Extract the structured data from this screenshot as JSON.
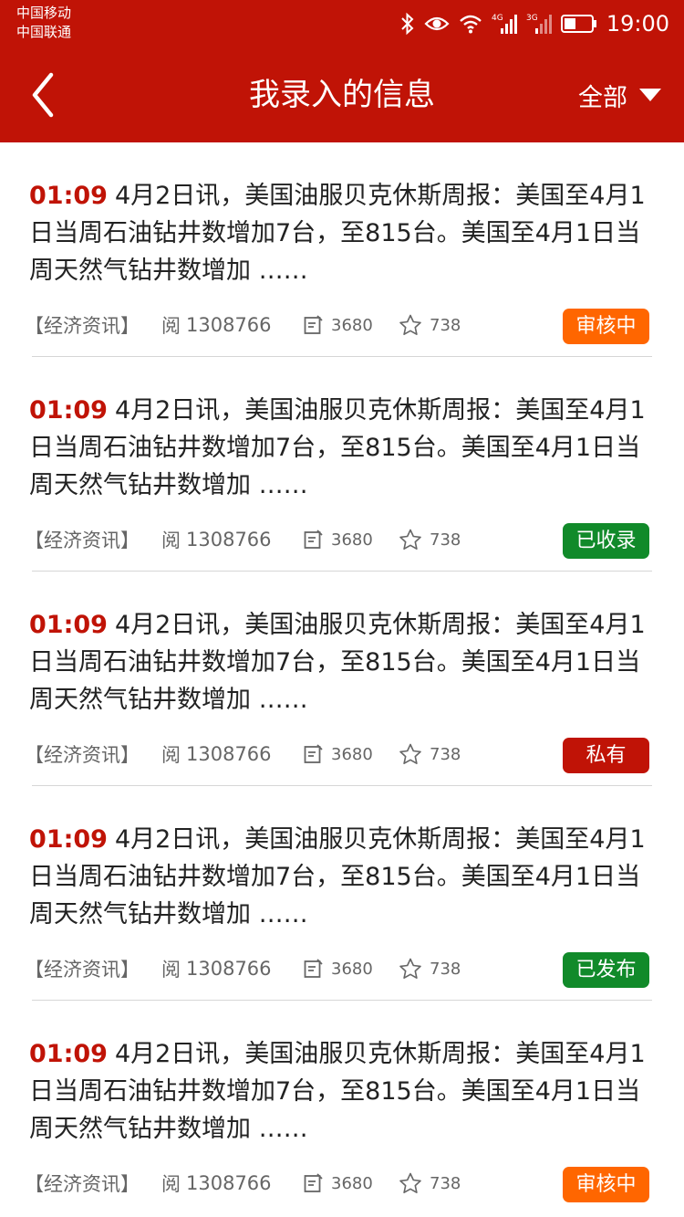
{
  "status_bar": {
    "carrier_1": "中国移动",
    "carrier_2": "中国联通",
    "network_1": "4G",
    "network_2": "3G",
    "time": "19:00",
    "icons": [
      "bluetooth-icon",
      "eye-icon",
      "wifi-icon",
      "signal-icon",
      "battery-icon"
    ]
  },
  "header": {
    "title": "我录入的信息",
    "filter_label": "全部",
    "back_icon": "chevron-left-icon",
    "filter_icon": "triangle-down-icon",
    "background_color": "#c01306"
  },
  "items": [
    {
      "time": "01:09",
      "text": "4月2日讯，美国油服贝克休斯周报：美国至4月1日当周石油钻井数增加7台，至815台。美国至4月1日当周天然气钻井数增加 ……",
      "category": "【经济资讯】",
      "read_label": "阅",
      "read_count": "1308766",
      "comments": "3680",
      "favorites": "738",
      "status": "审核中",
      "status_color": "#ff6600"
    },
    {
      "time": "01:09",
      "text": "4月2日讯，美国油服贝克休斯周报：美国至4月1日当周石油钻井数增加7台，至815台。美国至4月1日当周天然气钻井数增加 ……",
      "category": "【经济资讯】",
      "read_label": "阅",
      "read_count": "1308766",
      "comments": "3680",
      "favorites": "738",
      "status": "已收录",
      "status_color": "#118a2a"
    },
    {
      "time": "01:09",
      "text": "4月2日讯，美国油服贝克休斯周报：美国至4月1日当周石油钻井数增加7台，至815台。美国至4月1日当周天然气钻井数增加 ……",
      "category": "【经济资讯】",
      "read_label": "阅",
      "read_count": "1308766",
      "comments": "3680",
      "favorites": "738",
      "status": "私有",
      "status_color": "#c01306"
    },
    {
      "time": "01:09",
      "text": "4月2日讯，美国油服贝克休斯周报：美国至4月1日当周石油钻井数增加7台，至815台。美国至4月1日当周天然气钻井数增加 ……",
      "category": "【经济资讯】",
      "read_label": "阅",
      "read_count": "1308766",
      "comments": "3680",
      "favorites": "738",
      "status": "已发布",
      "status_color": "#118a2a"
    },
    {
      "time": "01:09",
      "text": "4月2日讯，美国油服贝克休斯周报：美国至4月1日当周石油钻井数增加7台，至815台。美国至4月1日当周天然气钻井数增加 ……",
      "category": "【经济资讯】",
      "read_label": "阅",
      "read_count": "1308766",
      "comments": "3680",
      "favorites": "738",
      "status": "审核中",
      "status_color": "#ff6600"
    }
  ]
}
